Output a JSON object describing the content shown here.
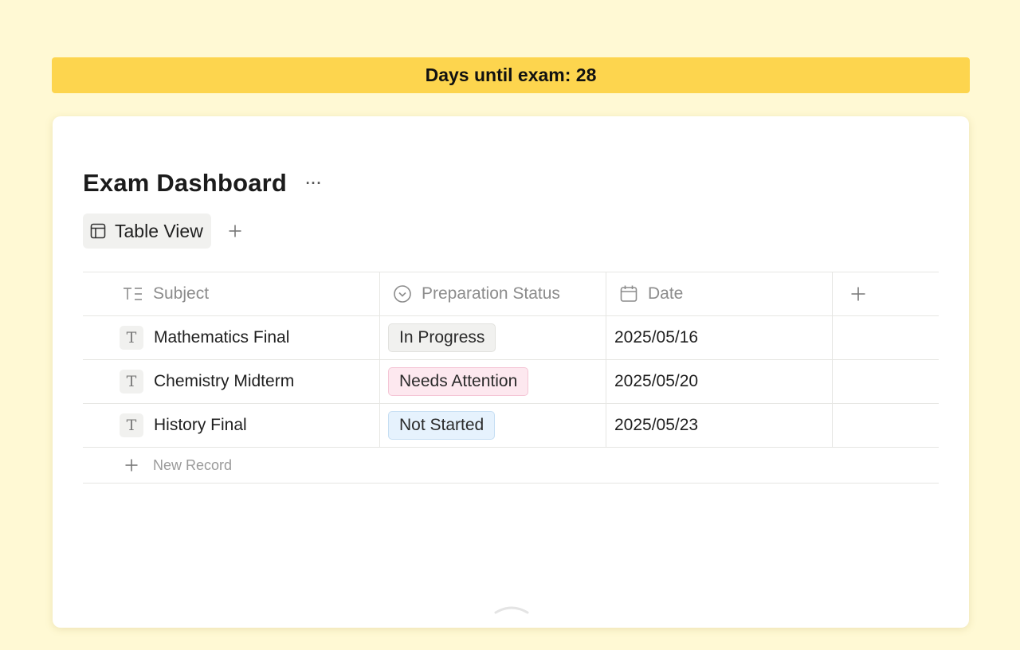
{
  "banner": {
    "text": "Days until exam: 28"
  },
  "page": {
    "title": "Exam Dashboard",
    "more_label": "···"
  },
  "views": {
    "active_label": "Table View",
    "icon": "table-layout-icon",
    "add_icon": "plus-icon"
  },
  "table": {
    "columns": [
      {
        "label": "Subject",
        "icon": "text-lines-icon"
      },
      {
        "label": "Preparation Status",
        "icon": "chevron-circle-icon"
      },
      {
        "label": "Date",
        "icon": "calendar-icon"
      }
    ],
    "add_column_icon": "plus-icon",
    "rows": [
      {
        "subject": "Mathematics Final",
        "status": "In Progress",
        "date": "2025/05/16"
      },
      {
        "subject": "Chemistry Midterm",
        "status": "Needs Attention",
        "date": "2025/05/20"
      },
      {
        "subject": "History Final",
        "status": "Not Started",
        "date": "2025/05/23"
      }
    ],
    "row_type_glyph": "T",
    "new_record_label": "New Record"
  },
  "colors": {
    "background": "#fff9d4",
    "banner": "#fdd54e",
    "status_in_progress": "#f1f1ef",
    "status_needs_attention": "#fde8ef",
    "status_not_started": "#e6f2fd"
  }
}
